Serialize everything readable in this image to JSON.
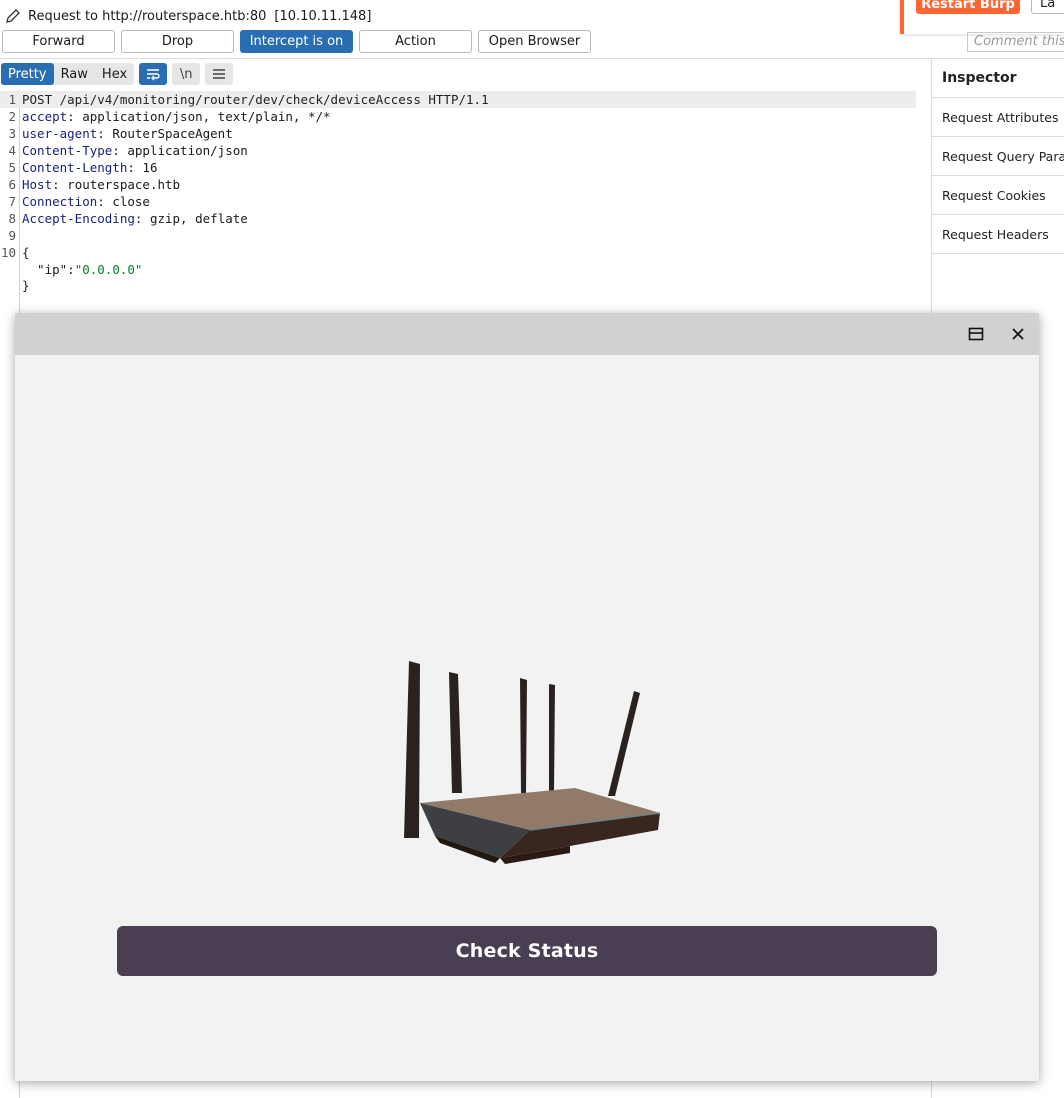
{
  "header": {
    "request_label": "Request to http://routerspace.htb:80",
    "ip": "[10.10.11.148]"
  },
  "toolbar": {
    "forward": "Forward",
    "drop": "Drop",
    "intercept": "Intercept is on",
    "action": "Action",
    "open_browser": "Open Browser"
  },
  "top_right": {
    "restart": "Restart Burp",
    "partial_button": "La",
    "comment_placeholder": "Comment this i"
  },
  "view_tabs": [
    "Pretty",
    "Raw",
    "Hex"
  ],
  "view_icons": [
    "wrap-icon",
    "newline-icon",
    "menu-icon"
  ],
  "newline_label": "\\n",
  "request": {
    "line_numbers": [
      "1",
      "2",
      "3",
      "4",
      "5",
      "6",
      "7",
      "8",
      "9",
      "10"
    ],
    "request_line": "POST /api/v4/monitoring/router/dev/check/deviceAccess HTTP/1.1",
    "headers": [
      {
        "name": "accept",
        "value": " application/json, text/plain, */*"
      },
      {
        "name": "user-agent",
        "value": " RouterSpaceAgent"
      },
      {
        "name": "Content-Type",
        "value": " application/json"
      },
      {
        "name": "Content-Length",
        "value": " 16"
      },
      {
        "name": "Host",
        "value": " routerspace.htb"
      },
      {
        "name": "Connection",
        "value": " close"
      },
      {
        "name": "Accept-Encoding",
        "value": " gzip, deflate"
      }
    ],
    "body_open": "{",
    "body_key": "  \"ip\":",
    "body_value": "\"0.0.0.0\"",
    "body_close": "}"
  },
  "inspector": {
    "title": "Inspector",
    "items": [
      "Request Attributes",
      "Request Query Parameters",
      "Request Cookies",
      "Request Headers"
    ]
  },
  "popup": {
    "button_label": "Check Status"
  },
  "colors": {
    "accent_blue": "#2a6eb2",
    "burp_orange": "#ff6633",
    "check_button": "#4a3e52"
  }
}
